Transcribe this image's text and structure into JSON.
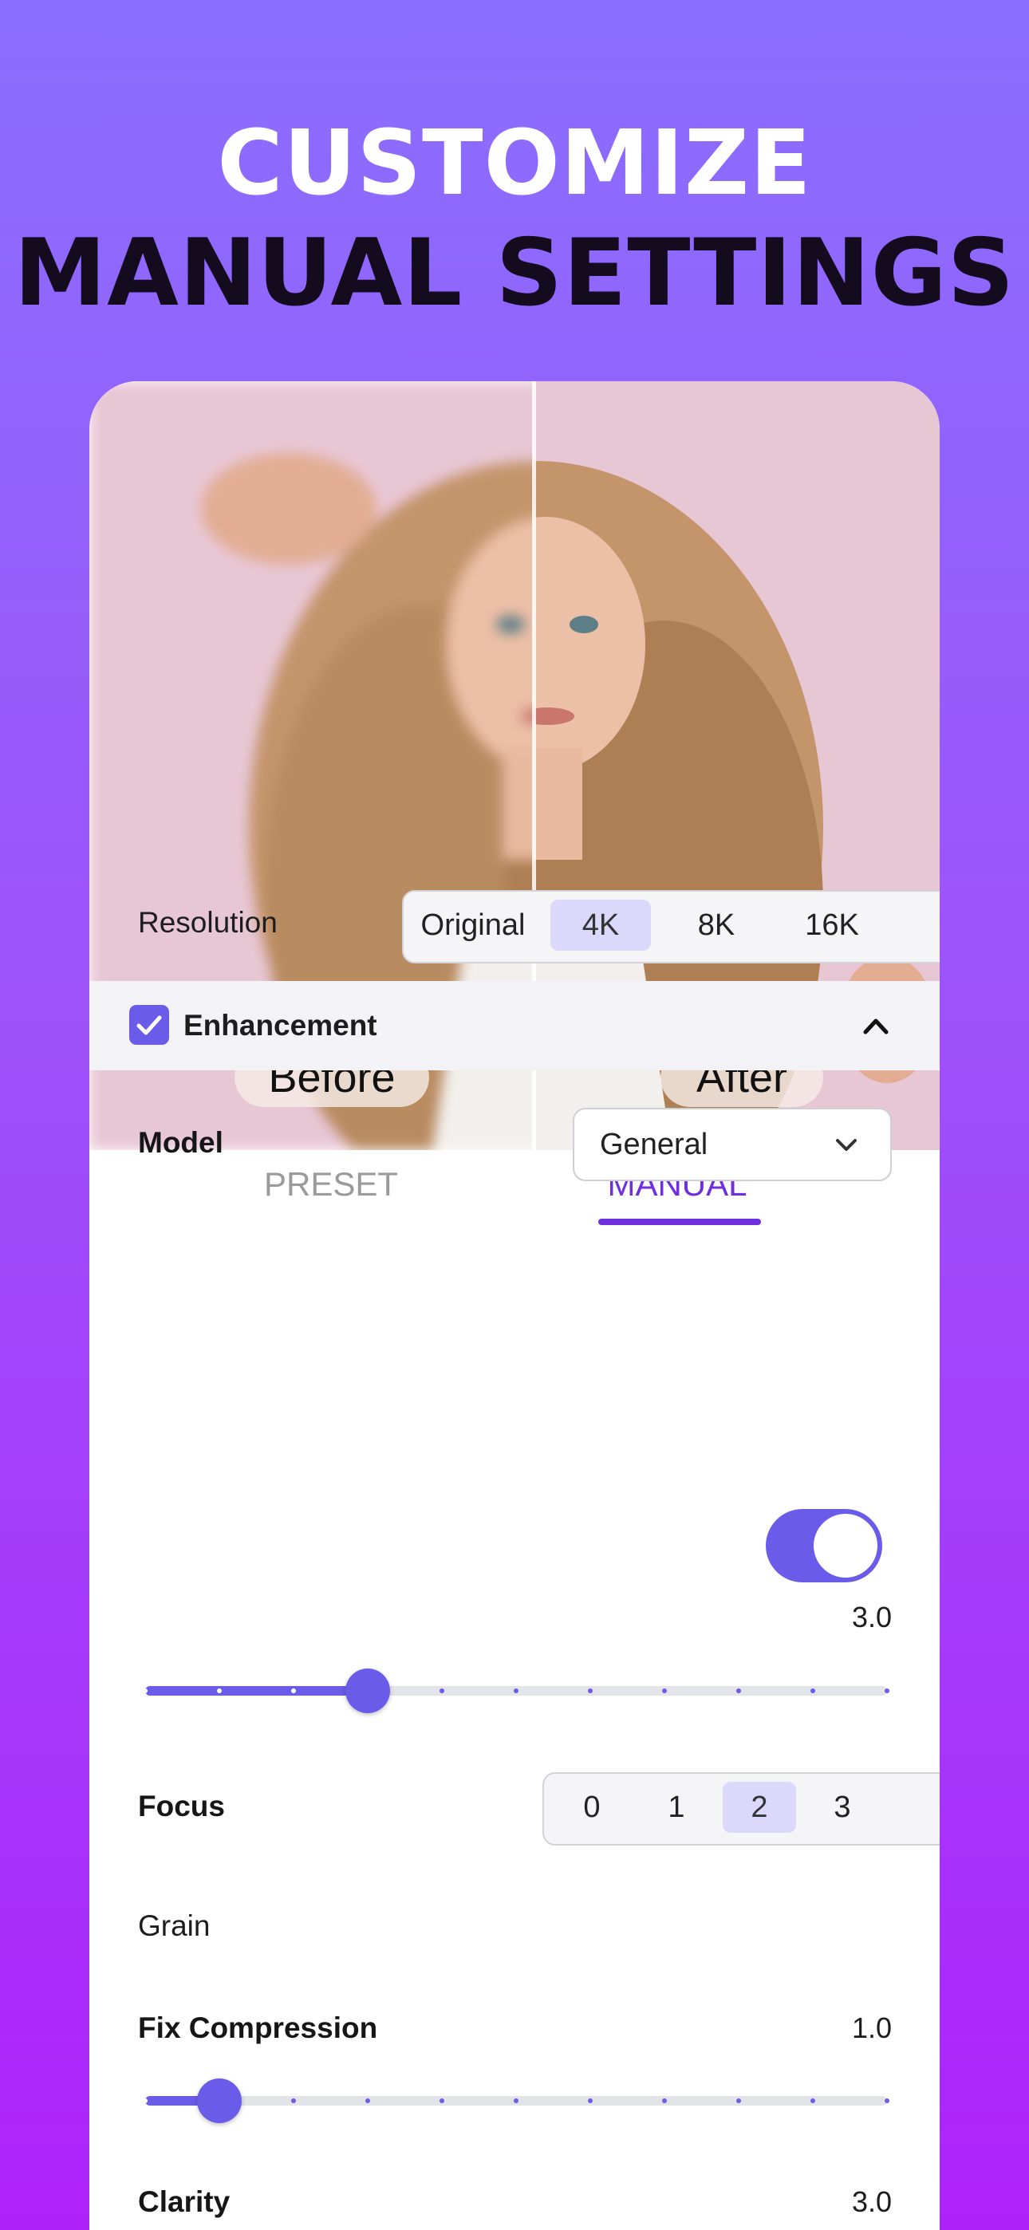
{
  "headline": {
    "line1": "CUSTOMIZE",
    "line2": "MANUAL SETTINGS"
  },
  "compare": {
    "before_label": "Before",
    "after_label": "After"
  },
  "tabs": {
    "preset": "PRESET",
    "manual": "MANUAL",
    "active": "MANUAL"
  },
  "resolution": {
    "label": "Resolution",
    "options": [
      "Original",
      "4K",
      "8K",
      "16K"
    ],
    "selected": "4K"
  },
  "enhancement": {
    "label": "Enhancement",
    "checked": true,
    "expanded": true
  },
  "model": {
    "label": "Model",
    "value": "General",
    "slider_value": "3.0",
    "slider_level": 0.3
  },
  "focus": {
    "label": "Focus",
    "options": [
      "0",
      "1",
      "2",
      "3"
    ],
    "selected": "2"
  },
  "grain": {
    "label": "Grain",
    "on": true
  },
  "fix_compression": {
    "label": "Fix Compression",
    "value": "1.0",
    "slider_level": 0.1
  },
  "clarity": {
    "label": "Clarity",
    "value": "3.0"
  },
  "colors": {
    "accent": "#6a5ce8",
    "tab_active": "#6f2ee0"
  }
}
